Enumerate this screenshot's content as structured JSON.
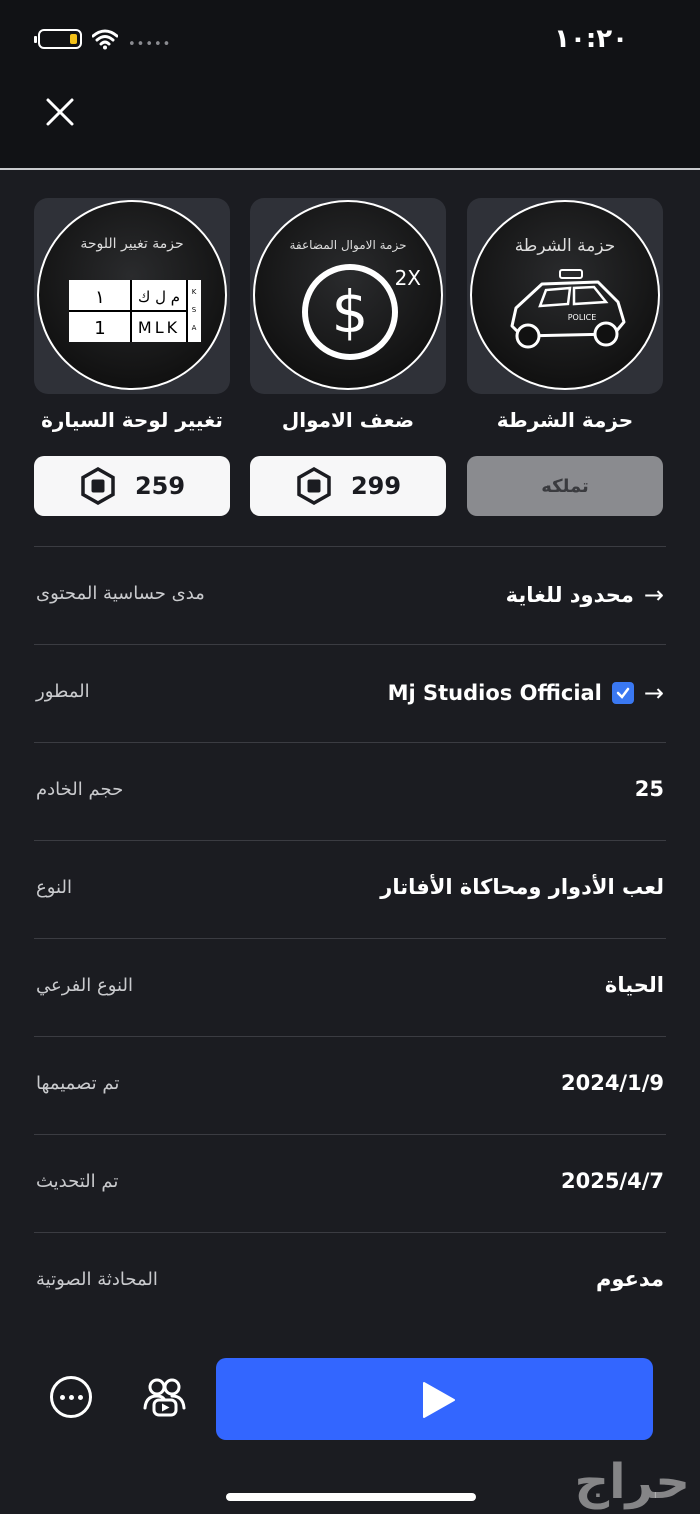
{
  "status_bar": {
    "time": "١٠:٢٠",
    "signal": "•••••"
  },
  "passes": [
    {
      "title": "تغيير لوحة السيارة",
      "thumb_label": "حزمة تغيير اللوحة",
      "price": "259",
      "plate": {
        "ar_num": "١",
        "ar_text": "م ل ك",
        "en_num": "1",
        "en_text": "MLK",
        "side": "KSA"
      }
    },
    {
      "title": "ضعف الاموال",
      "thumb_label": "حزمة الاموال المضاعفة",
      "price": "299",
      "badge": "2X"
    },
    {
      "title": "حزمة الشرطة",
      "thumb_label": "حزمة الشرطة",
      "button_label": "تملكه",
      "car_label": "POLICE"
    }
  ],
  "details": [
    {
      "label": "مدى حساسية المحتوى",
      "value": "محدود للغاية",
      "arrow": true,
      "verified": false
    },
    {
      "label": "المطور",
      "value": "Mj Studios Official",
      "arrow": true,
      "verified": true
    },
    {
      "label": "حجم الخادم",
      "value": "25",
      "arrow": false,
      "verified": false
    },
    {
      "label": "النوع",
      "value": "لعب الأدوار ومحاكاة الأفاتار",
      "arrow": false,
      "verified": false
    },
    {
      "label": "النوع الفرعي",
      "value": "الحياة",
      "arrow": false,
      "verified": false
    },
    {
      "label": "تم تصميمها",
      "value": "2024/1/9",
      "arrow": false,
      "verified": false
    },
    {
      "label": "تم التحديث",
      "value": "2025/4/7",
      "arrow": false,
      "verified": false
    },
    {
      "label": "المحادثة الصوتية",
      "value": "مدعوم",
      "arrow": false,
      "verified": false
    }
  ],
  "watermark": "حراج",
  "colors": {
    "play": "#3366ff",
    "verified": "#3a78f2",
    "battery": "#f2c019"
  }
}
